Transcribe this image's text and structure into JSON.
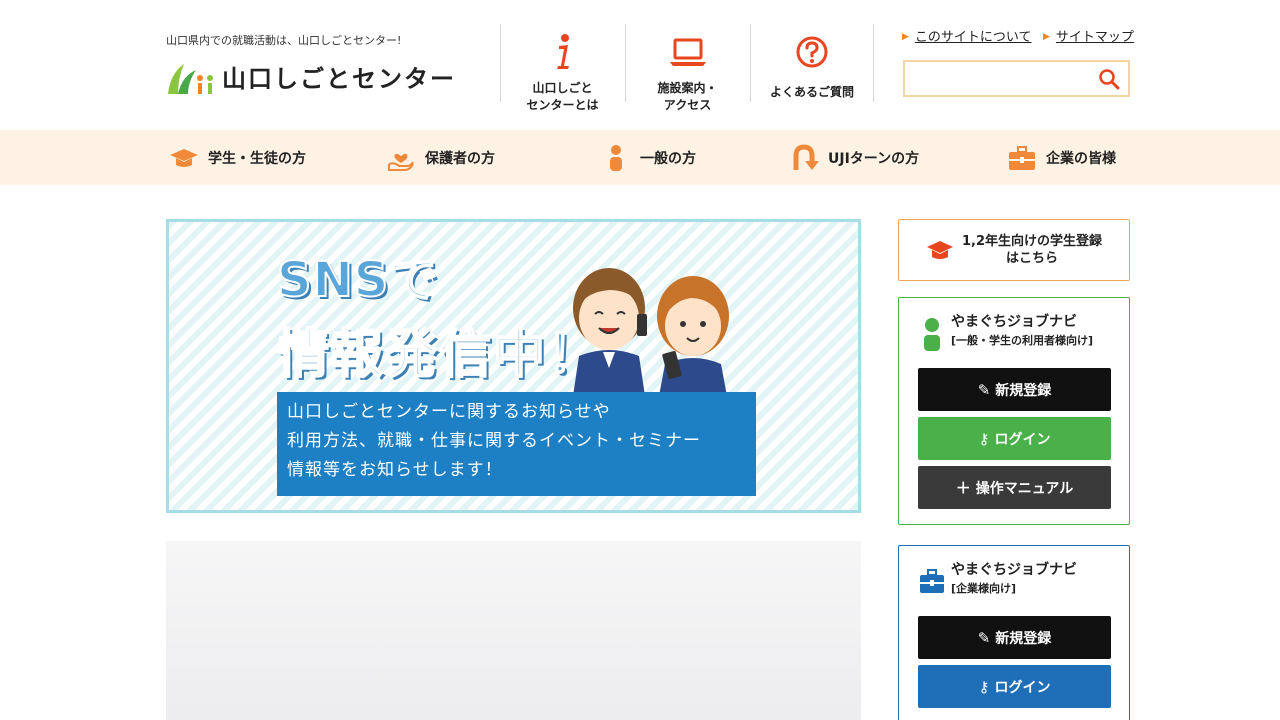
{
  "header": {
    "tagline": "山口県内での就職活動は、山口しごとセンター!",
    "logo_text": "山口しごとセンター",
    "nav": [
      {
        "label": "山口しごと\nセンターとは",
        "icon": "info-icon"
      },
      {
        "label": "施設案内・\nアクセス",
        "icon": "laptop-icon"
      },
      {
        "label": "よくあるご質問",
        "icon": "question-icon"
      }
    ],
    "util_links": [
      "このサイトについて",
      "サイトマップ"
    ],
    "search": {
      "placeholder": "",
      "value": ""
    }
  },
  "categories": [
    {
      "label": "学生・生徒の方",
      "icon": "graduation-cap-icon"
    },
    {
      "label": "保護者の方",
      "icon": "heart-hand-icon"
    },
    {
      "label": "一般の方",
      "icon": "person-icon"
    },
    {
      "label": "UJIターンの方",
      "icon": "u-turn-arrow-icon"
    },
    {
      "label": "企業の皆様",
      "icon": "briefcase-icon"
    }
  ],
  "banner": {
    "heading_1": "SNSで",
    "heading_2": "情報発信中！",
    "lines": [
      "山口しごとセンターに関するお知らせや",
      "利用方法、就職・仕事に関するイベント・セミナー",
      "情報等をお知らせします！"
    ]
  },
  "sidebar": {
    "register_student": "1,2年生向けの学生登録\nはこちら",
    "jobnavi_user": {
      "title": "やまぐちジョブナビ",
      "subtitle": "[一般・学生の利用者様向け]",
      "buttons": [
        "新規登録",
        "ログイン",
        "操作マニュアル"
      ]
    },
    "jobnavi_company": {
      "title": "やまぐちジョブナビ",
      "subtitle": "[企業様向け]",
      "buttons": [
        "新規登録",
        "ログイン"
      ]
    }
  },
  "colors": {
    "accent_orange": "#f0841e",
    "nav_bg": "#fdf2e3",
    "green": "#4ab04a",
    "blue": "#1f6fb8",
    "banner_box": "#1d7fc4"
  }
}
